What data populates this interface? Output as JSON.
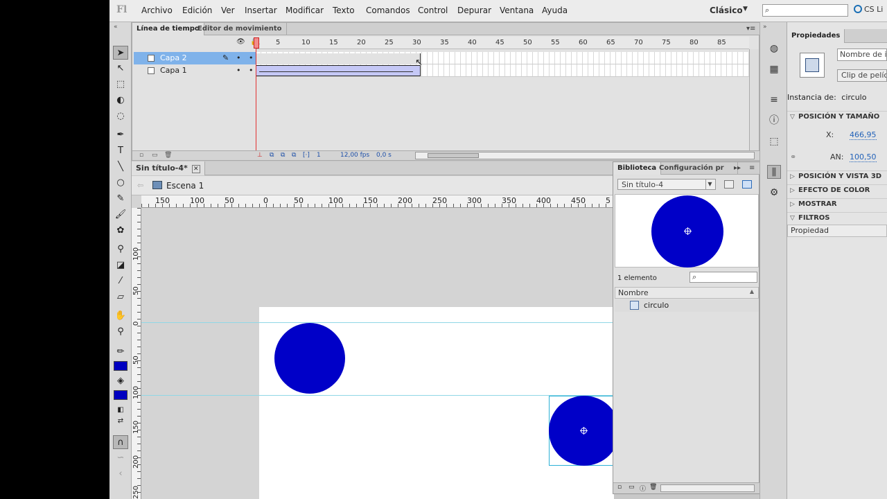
{
  "app": {
    "logo": "Fl",
    "menus": [
      "Archivo",
      "Edición",
      "Ver",
      "Insertar",
      "Modificar",
      "Texto",
      "Comandos",
      "Control",
      "Depurar",
      "Ventana",
      "Ayuda"
    ],
    "workspace": "Clásico",
    "cs_live": "CS Li"
  },
  "timeline": {
    "tabs": [
      "Línea de tiempo",
      "Editor de movimiento"
    ],
    "frame_numbers": [
      "1",
      "5",
      "10",
      "15",
      "20",
      "25",
      "30",
      "35",
      "40",
      "45",
      "50",
      "55",
      "60",
      "65",
      "70",
      "75",
      "80",
      "85"
    ],
    "layers": [
      {
        "name": "Capa 2",
        "selected": true,
        "color": "#a040c0"
      },
      {
        "name": "Capa 1",
        "selected": false,
        "color": "#50e050"
      }
    ],
    "tween_start_frame": 1,
    "tween_end_frame": 30,
    "current_frame": "1",
    "fps": "12,00 fps",
    "time": "0,0 s"
  },
  "document": {
    "tab": "Sin título-4*",
    "scene": "Escena 1",
    "hruler": [
      "150",
      "100",
      "50",
      "0",
      "50",
      "100",
      "150",
      "200",
      "250",
      "300",
      "350",
      "400",
      "450",
      "5"
    ],
    "vruler": [
      "100",
      "50",
      "0",
      "50",
      "100",
      "150",
      "200",
      "250"
    ],
    "shape_color": "#0000c8"
  },
  "library": {
    "tabs": [
      "Biblioteca",
      "Configuración pr"
    ],
    "document": "Sin título-4",
    "count": "1 elemento",
    "column_name": "Nombre",
    "items": [
      "circulo"
    ]
  },
  "properties": {
    "tab": "Propiedades",
    "name_placeholder": "Nombre de in",
    "symbol_type": "Clip de pelíc",
    "instance_label": "Instancia de:",
    "instance_name": "circulo",
    "sections": {
      "position_size": "POSICIÓN Y TAMAÑO",
      "position_3d": "POSICIÓN Y VISTA 3D",
      "color_effect": "EFECTO DE COLOR",
      "display": "MOSTRAR",
      "filters": "FILTROS"
    },
    "x_label": "X:",
    "x_value": "466,95",
    "w_label": "AN:",
    "w_value": "100,50",
    "column": "Propiedad"
  }
}
